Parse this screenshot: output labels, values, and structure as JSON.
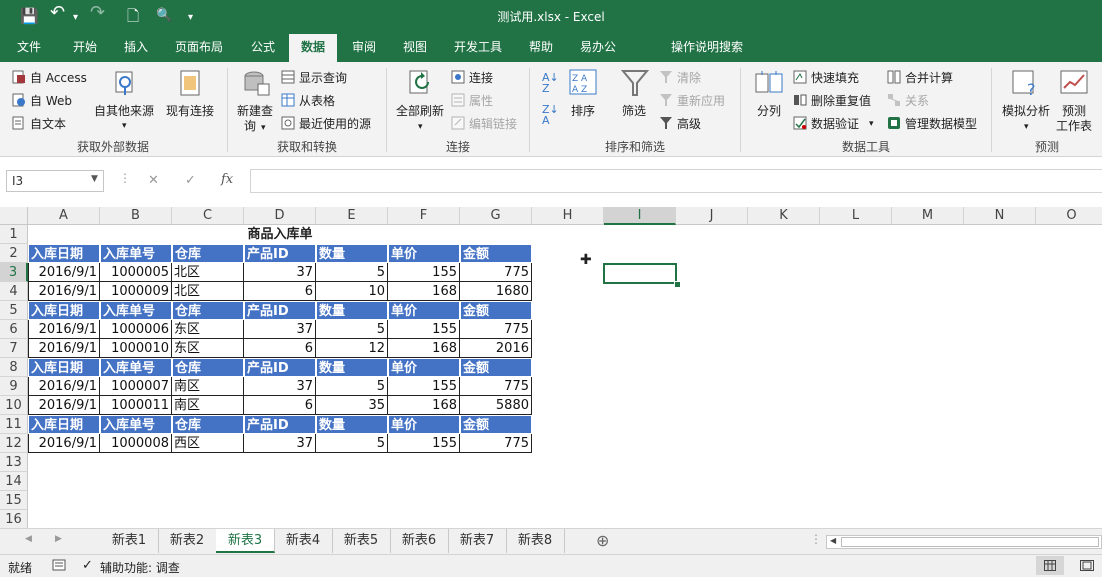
{
  "titlebar": {
    "title": "测试用.xlsx  -  Excel",
    "save_glyph": "💾",
    "undo_glyph": "↶",
    "redo_glyph": "↷",
    "new_glyph": "🗋",
    "preview_glyph": "🔍",
    "more_glyph": "▾"
  },
  "tabs": [
    "文件",
    "开始",
    "插入",
    "页面布局",
    "公式",
    "数据",
    "审阅",
    "视图",
    "开发工具",
    "帮助",
    "易办公",
    "操作说明搜索"
  ],
  "active_tab": "数据",
  "ribbon": {
    "get_external": {
      "access": "自 Access",
      "web": "自 Web",
      "text": "自文本",
      "other": "自其他来源",
      "existing": "现有连接",
      "label": "获取外部数据"
    },
    "get_transform": {
      "new_query_1": "新建查",
      "new_query_2": "询",
      "show_queries": "显示查询",
      "from_table": "从表格",
      "recent_sources": "最近使用的源",
      "label": "获取和转换"
    },
    "connections": {
      "refresh_all": "全部刷新",
      "connections": "连接",
      "properties": "属性",
      "edit_links": "编辑链接",
      "label": "连接"
    },
    "sort_filter": {
      "sort": "排序",
      "filter": "筛选",
      "clear": "清除",
      "reapply": "重新应用",
      "advanced": "高级",
      "label": "排序和筛选"
    },
    "data_tools": {
      "split": "分列",
      "flash_fill": "快速填充",
      "remove_dup": "删除重复值",
      "validation": "数据验证",
      "consolidate": "合并计算",
      "relationships": "关系",
      "data_model": "管理数据模型",
      "label": "数据工具"
    },
    "forecast": {
      "what_if": "模拟分析",
      "sheet_1": "预测",
      "sheet_2": "工作表",
      "label": "预测"
    }
  },
  "formula_bar": {
    "name_box": "I3",
    "cancel": "✕",
    "enter": "✓",
    "fx": "fx",
    "formula": ""
  },
  "grid": {
    "columns": [
      "A",
      "B",
      "C",
      "D",
      "E",
      "F",
      "G",
      "H",
      "I",
      "J",
      "K",
      "L",
      "M",
      "N",
      "O"
    ],
    "selected_column": "I",
    "rows": [
      "1",
      "2",
      "3",
      "4",
      "5",
      "6",
      "7",
      "8",
      "9",
      "10",
      "11",
      "12",
      "13",
      "14",
      "15",
      "16"
    ],
    "selected_row": "3",
    "table_title": "商品入库单",
    "header": [
      "入库日期",
      "入库单号",
      "仓库",
      "产品ID",
      "数量",
      "单价",
      "金额"
    ],
    "blocks": [
      {
        "row": "3",
        "values": [
          "2016/9/1",
          "1000005",
          "北区",
          "37",
          "5",
          "155",
          "775"
        ]
      },
      {
        "row": "4",
        "values": [
          "2016/9/1",
          "1000009",
          "北区",
          "6",
          "10",
          "168",
          "1680"
        ]
      },
      {
        "row": "6",
        "values": [
          "2016/9/1",
          "1000006",
          "东区",
          "37",
          "5",
          "155",
          "775"
        ]
      },
      {
        "row": "7",
        "values": [
          "2016/9/1",
          "1000010",
          "东区",
          "6",
          "12",
          "168",
          "2016"
        ]
      },
      {
        "row": "9",
        "values": [
          "2016/9/1",
          "1000007",
          "南区",
          "37",
          "5",
          "155",
          "775"
        ]
      },
      {
        "row": "10",
        "values": [
          "2016/9/1",
          "1000011",
          "南区",
          "6",
          "35",
          "168",
          "5880"
        ]
      },
      {
        "row": "12",
        "values": [
          "2016/9/1",
          "1000008",
          "西区",
          "37",
          "5",
          "155",
          "775"
        ]
      }
    ],
    "header_color": "#4472c4",
    "accent": "#217346"
  },
  "sheets": [
    "新表1",
    "新表2",
    "新表3",
    "新表4",
    "新表5",
    "新表6",
    "新表7",
    "新表8"
  ],
  "active_sheet": "新表3",
  "status": {
    "ready": "就绪",
    "accessibility": "辅助功能: 调查"
  }
}
